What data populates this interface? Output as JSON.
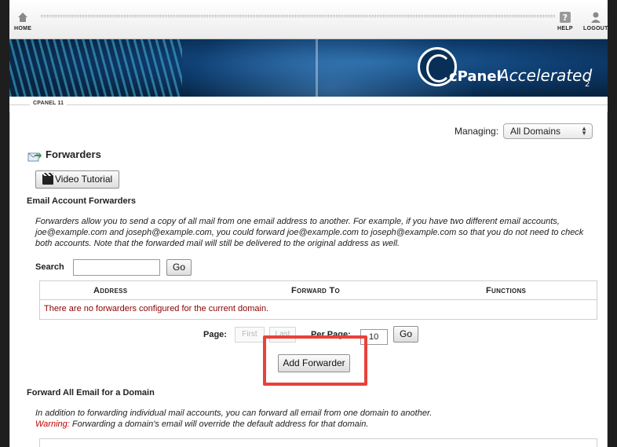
{
  "topbar": {
    "home_label": "HOME",
    "help_label": "HELP",
    "logout_label": "LOGOUT"
  },
  "banner": {
    "brand_cpanel": "cPanel",
    "brand_accelerated": "Accelerated",
    "brand_version": "2"
  },
  "version_tab": "CPANEL 11",
  "managing": {
    "label": "Managing:",
    "selected": "All Domains"
  },
  "page_title": "Forwarders",
  "video_tutorial_label": "Video Tutorial",
  "email_section": {
    "heading": "Email Account Forwarders",
    "description": "Forwarders allow you to send a copy of all mail from one email address to another. For example, if you have two different email accounts, joe@example.com and joseph@example.com, you could forward joe@example.com to joseph@example.com so that you do not need to check both accounts. Note that the forwarded mail will still be delivered to the original address as well."
  },
  "search": {
    "label": "Search",
    "value": "",
    "go_label": "Go"
  },
  "table": {
    "columns": [
      "Address",
      "Forward To",
      "Functions"
    ],
    "empty_message": "There are no forwarders configured for the current domain."
  },
  "pagination": {
    "page_label": "Page:",
    "first_label": "First",
    "last_label": "Last",
    "per_page_label": "Per Page:",
    "per_page_value": "10",
    "go_label": "Go"
  },
  "add_forwarder_label": "Add Forwarder",
  "domain_section": {
    "heading": "Forward All Email for a Domain",
    "description": "In addition to forwarding individual mail accounts, you can forward all email from one domain to another.",
    "warning_prefix": "Warning:",
    "warning_text": "Forwarding a domain's email will override the default address for that domain."
  },
  "colors": {
    "highlight": "#e8413a",
    "error_text": "#8b0000",
    "warning_text": "#c00000",
    "banner_blue": "#0e3c6e"
  }
}
